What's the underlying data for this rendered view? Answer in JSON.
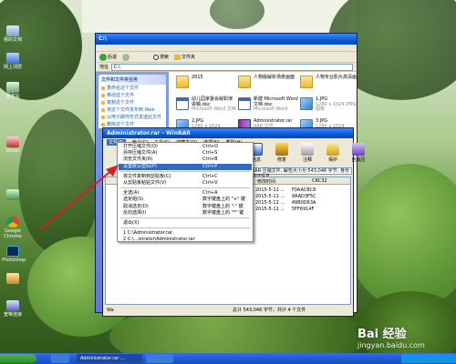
{
  "desktop": {
    "icons": [
      {
        "label": "我的文档",
        "icon": "documents-icon"
      },
      {
        "label": "网上邻居",
        "icon": "network-icon"
      },
      {
        "label": "回收站",
        "icon": "recycle-bin-icon"
      },
      {
        "label": "Ghost",
        "icon": "ghost-icon"
      },
      {
        "label": "",
        "icon": "app-icon"
      },
      {
        "label": "Google Chrome",
        "icon": "chrome-icon"
      },
      {
        "label": "Photoshop",
        "icon": "photoshop-icon"
      },
      {
        "label": "",
        "icon": "app-icon"
      },
      {
        "label": "宽带连接",
        "icon": "broadband-icon"
      }
    ]
  },
  "explorer": {
    "title": "C:\\",
    "back_label": "后退",
    "search_label": "搜索",
    "folders_label": "文件夹",
    "address_label": "地址",
    "address_value": "C:\\",
    "left_panel": {
      "header": "文件和文件夹任务",
      "tasks": [
        "重命名这个文件",
        "移动这个文件",
        "复制这个文件",
        "将这个文件发布到 Web",
        "以电子邮件形式发送此文件",
        "删除这个文件"
      ]
    },
    "files": [
      {
        "name": "2015",
        "sub": "",
        "type": "folder"
      },
      {
        "name": "人物版解析场景画面",
        "sub": "",
        "type": "folder"
      },
      {
        "name": "人物专业影片高清画",
        "sub": "",
        "type": "folder"
      },
      {
        "name": "幼儿园家委会就职演讲稿.doc",
        "sub": "Microsoft Word 文档",
        "type": "doc"
      },
      {
        "name": "新建 Microsoft Word 文档.doc",
        "sub": "Microsoft Word",
        "type": "doc"
      },
      {
        "name": "1.JPG",
        "sub": "1280 x 1024 JPEG 图像",
        "type": "img"
      },
      {
        "name": "2.JPG",
        "sub": "1280 x 1024",
        "type": "img"
      },
      {
        "name": "Administrator.rar",
        "sub": "RAR 文件",
        "type": "rar"
      },
      {
        "name": "3.JPG",
        "sub": "1280 x 1024",
        "type": "img"
      }
    ]
  },
  "winrar": {
    "title": "Administrator.rar - WinRAR",
    "menu": [
      "文件(F)",
      "命令(C)",
      "工具(S)",
      "收藏夹(O)",
      "选项(N)",
      "帮助(H)"
    ],
    "tools": [
      {
        "label": "信息",
        "icon": "info-icon"
      },
      {
        "label": "修复",
        "icon": "repair-icon"
      },
      {
        "label": "注释",
        "icon": "comment-icon"
      },
      {
        "label": "保护",
        "icon": "protect-icon"
      },
      {
        "label": "自解压",
        "icon": "sfx-icon"
      }
    ],
    "address_value": "RAR 压缩文件, 解包大小为 543,046 字节, 身份验证信息",
    "header": {
      "crc": "CRC32",
      "modified": "修改时间"
    },
    "rows": [
      {
        "date": "2015-5-11 ...",
        "crc": "F0AACBC8"
      },
      {
        "date": "2015-5-11 ...",
        "crc": "9AAD3F5C"
      },
      {
        "date": "2015-5-11 ...",
        "crc": "49B0D63A"
      },
      {
        "date": "2015-5-11 ...",
        "crc": "5FF6914F"
      }
    ],
    "status_left": "Wa",
    "status_right": "总计 543,046 字节，共计 4 个文件"
  },
  "file_menu": {
    "items": [
      {
        "label": "打开压缩文件(O)",
        "shortcut": "Ctrl+O"
      },
      {
        "label": "另存压缩文件(A)",
        "shortcut": "Ctrl+S"
      },
      {
        "label": "浏览文件夹(R)",
        "shortcut": "Ctrl+B"
      },
      {
        "label": "设置默认密码(P)",
        "shortcut": "Ctrl+P"
      },
      {
        "label": "将文件复制到剪贴板(C)",
        "shortcut": "Ctrl+C"
      },
      {
        "label": "从剪贴板粘贴文件(V)",
        "shortcut": "Ctrl+V"
      },
      {
        "label": "全选(A)",
        "shortcut": "Ctrl+A"
      },
      {
        "label": "选定组(S)",
        "shortcut": "数字键盘上的 \"+\" 键"
      },
      {
        "label": "取消选定(D)",
        "shortcut": "数字键盘上的 \"-\" 键"
      },
      {
        "label": "反向选择(I)",
        "shortcut": "数字键盘上的 \"*\" 键"
      },
      {
        "label": "退出(X)",
        "shortcut": ""
      },
      {
        "label": "1  C:\\Administrator.rar",
        "shortcut": ""
      },
      {
        "label": "2  C:\\...istrator\\Administrator.rar",
        "shortcut": ""
      }
    ],
    "highlighted_index": 3
  },
  "taskbar": {
    "start_label": "",
    "buttons": [
      "",
      "Administrator.rar ...",
      ""
    ]
  },
  "watermark": {
    "logo": "Bai 经验",
    "url": "jingyan.baidu.com"
  },
  "colors": {
    "arrow": "#d62020",
    "highlight": "#316ac5",
    "xp_blue": "#0a58d6"
  }
}
